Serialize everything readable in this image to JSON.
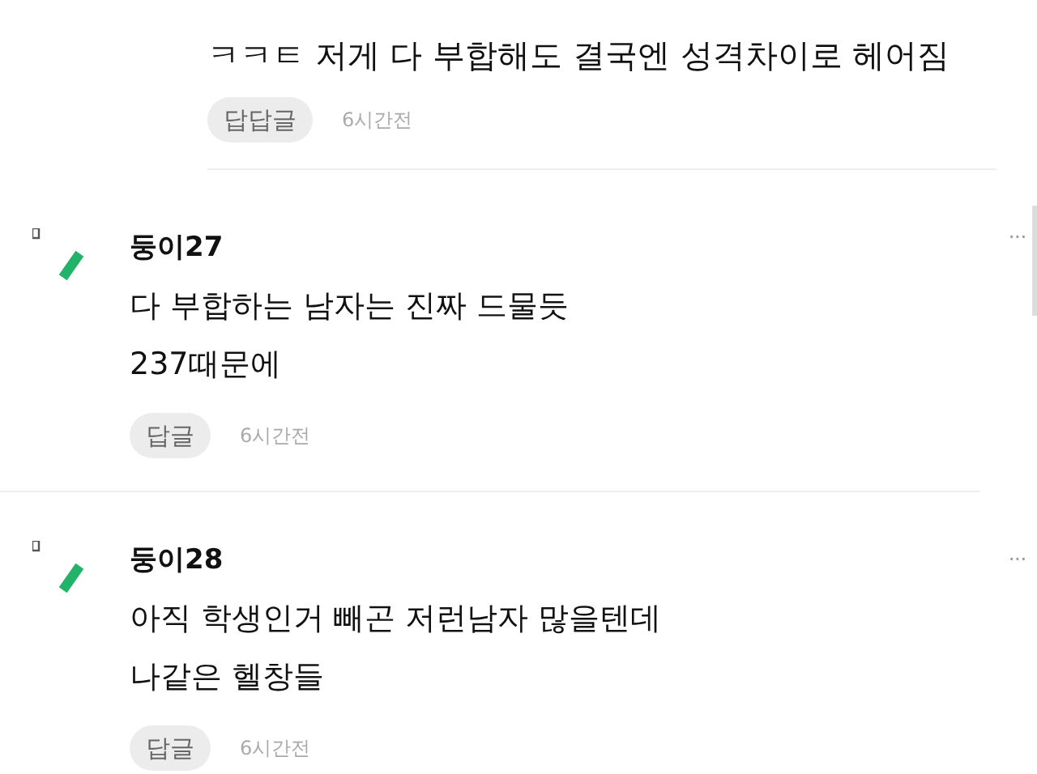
{
  "reply": {
    "text": "ㅋㅋㅌ 저게 다 부합해도 결국엔 성격차이로 헤어짐",
    "reply_button": "답답글",
    "time": "6시간전"
  },
  "comments": [
    {
      "author": "둥이27",
      "lines": [
        "다 부합하는 남자는 진짜 드물듯",
        "237때문에"
      ],
      "reply_button": "답글",
      "time": "6시간전",
      "menu": "···"
    },
    {
      "author": "둥이28",
      "lines": [
        "아직 학생인거 빼곤 저런남자 많을텐데",
        "나같은 헬창들"
      ],
      "reply_button": "답글",
      "time": "6시간전",
      "menu": "···"
    }
  ]
}
